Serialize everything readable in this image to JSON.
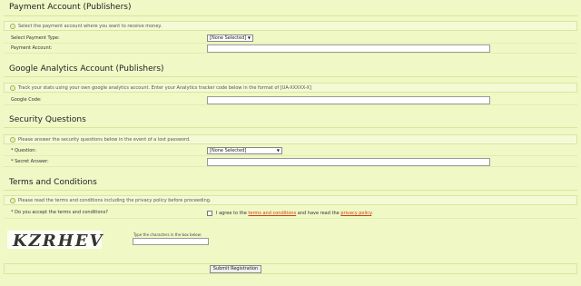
{
  "sections": [
    {
      "title": "Payment Account (Publishers)",
      "info": "Select the payment account where you want to receive money.",
      "rows": [
        {
          "label": "Select Payment Type:",
          "value": "[None Selected]"
        },
        {
          "label": "Payment Account:",
          "value": ""
        }
      ]
    },
    {
      "title": "Google Analytics Account (Publishers)",
      "info": "Track your stats using your own google analytics account. Enter your Analytics tracker code below in the format of [UA-XXXXX-X]",
      "rows": [
        {
          "label": "Google Code:",
          "value": ""
        }
      ]
    },
    {
      "title": "Security Questions",
      "info": "Please answer the security questions below in the event of a lost password.",
      "rows": [
        {
          "label": "* Question:",
          "value": "[None Selected]"
        },
        {
          "label": "* Secret Answer:",
          "value": ""
        }
      ]
    },
    {
      "title": "Terms and Conditions",
      "info": "Please read the terms and conditions including the privacy policy before proceeding.",
      "rows": [
        {
          "label": "* Do you accept the terms and conditions?",
          "value": ""
        }
      ]
    }
  ],
  "terms": {
    "prefix": "I agree to the",
    "terms_link": "terms and conditions",
    "middle": "and have read the",
    "privacy_link": "privacy policy",
    "suffix": "."
  },
  "captcha": {
    "image_text": "KZRHEV",
    "hint": "Type the characters in the box below:",
    "value": ""
  },
  "submit_label": "Submit Registration",
  "info_icon": "info-icon",
  "colors": {
    "background": "#f0f8c6",
    "link": "#d04010"
  }
}
